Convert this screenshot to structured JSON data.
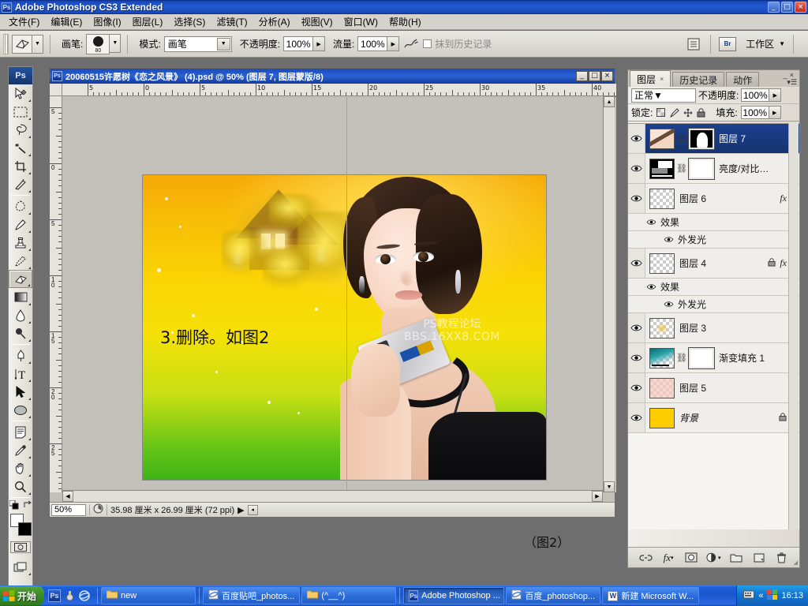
{
  "app": {
    "title": "Adobe Photoshop CS3 Extended",
    "badge": "Ps",
    "min": "_",
    "max": "□",
    "close": "×"
  },
  "menu": {
    "items": [
      {
        "label": "文件(F)"
      },
      {
        "label": "编辑(E)"
      },
      {
        "label": "图像(I)"
      },
      {
        "label": "图层(L)"
      },
      {
        "label": "选择(S)"
      },
      {
        "label": "滤镜(T)"
      },
      {
        "label": "分析(A)"
      },
      {
        "label": "视图(V)"
      },
      {
        "label": "窗口(W)"
      },
      {
        "label": "帮助(H)"
      }
    ]
  },
  "options": {
    "tool_icon": "eraser-icon",
    "brush_label": "画笔:",
    "brush_size": "80",
    "mode_label": "模式:",
    "mode_value": "画笔",
    "opacity_label": "不透明度:",
    "opacity_value": "100%",
    "flow_label": "流量:",
    "flow_value": "100%",
    "airbrush_icon": "airbrush-icon",
    "erase_history_label": "抹到历史记录",
    "palette_icon": "palette-toggle-icon",
    "bridge_icon": "Br",
    "workspace_label": "工作区",
    "workspace_arrow": "▼"
  },
  "toolbar": {
    "badge": "Ps",
    "tools": [
      {
        "name": "move-tool",
        "glyph": "✥",
        "selected": false
      },
      {
        "name": "marquee-tool",
        "glyph": "▭",
        "selected": false
      },
      {
        "name": "lasso-tool",
        "glyph": "◠",
        "selected": false
      },
      {
        "name": "magic-wand-tool",
        "glyph": "✳",
        "selected": false
      },
      {
        "name": "crop-tool",
        "glyph": "⌗",
        "selected": false
      },
      {
        "name": "slice-tool",
        "glyph": "✂",
        "selected": false
      },
      {
        "name": "healing-brush-tool",
        "glyph": "◌",
        "selected": false
      },
      {
        "name": "brush-tool",
        "glyph": "✎",
        "selected": false
      },
      {
        "name": "clone-stamp-tool",
        "glyph": "⛁",
        "selected": false
      },
      {
        "name": "history-brush-tool",
        "glyph": "⟲",
        "selected": false
      },
      {
        "name": "eraser-tool",
        "glyph": "▱",
        "selected": true
      },
      {
        "name": "gradient-tool",
        "glyph": "▤",
        "selected": false
      },
      {
        "name": "blur-tool",
        "glyph": "💧",
        "selected": false
      },
      {
        "name": "dodge-tool",
        "glyph": "⚲",
        "selected": false
      },
      {
        "name": "pen-tool",
        "glyph": "✒",
        "selected": false
      },
      {
        "name": "type-tool",
        "glyph": "T",
        "selected": false
      },
      {
        "name": "path-selection-tool",
        "glyph": "➤",
        "selected": false
      },
      {
        "name": "shape-tool",
        "glyph": "⬭",
        "selected": false
      },
      {
        "name": "notes-tool",
        "glyph": "▤",
        "selected": false
      },
      {
        "name": "eyedropper-tool",
        "glyph": "⟋",
        "selected": false
      },
      {
        "name": "hand-tool",
        "glyph": "✋",
        "selected": false
      },
      {
        "name": "zoom-tool",
        "glyph": "🔍",
        "selected": false
      }
    ],
    "foreground_color": "#ffffff",
    "background_color": "#000000",
    "quickmask_icon": "quick-mask-icon",
    "screenmode_icon": "screen-mode-icon"
  },
  "document": {
    "title": "20060515许愿树《恋之风景》 (4).psd @ 50% (图层 7, 图层蒙版/8)",
    "badge": "Ps",
    "min": "_",
    "max": "□",
    "close": "×",
    "ruler_h": [
      "5",
      "0",
      "5",
      "10",
      "15",
      "20",
      "25",
      "30",
      "35",
      "40"
    ],
    "ruler_v": [
      "5",
      "0",
      "5",
      "10",
      "15",
      "20",
      "25",
      "30"
    ],
    "canvas_text": "3.删除。如图2",
    "watermark_line1": "PS教程论坛",
    "watermark_line2": "BBS.16XX8.COM",
    "status": {
      "zoom": "50%",
      "doc_size": "35.98 厘米 x 26.99 厘米 (72 ppi)",
      "arrow": "▶"
    }
  },
  "figure_caption": "（图2）",
  "panel": {
    "tabs": [
      {
        "label": "图层",
        "active": true,
        "close": "×"
      },
      {
        "label": "历史记录",
        "active": false
      },
      {
        "label": "动作",
        "active": false
      }
    ],
    "minimize": "_",
    "close": "×",
    "menu_icon": "panel-menu-icon",
    "blend_mode": "正常",
    "opacity_label": "不透明度:",
    "opacity_value": "100%",
    "lock_label": "锁定:",
    "lock_icons": [
      "lock-transparency-icon",
      "lock-pixels-icon",
      "lock-position-icon",
      "lock-all-icon"
    ],
    "fill_label": "填充:",
    "fill_value": "100%",
    "layers": [
      {
        "name": "图层 7",
        "selected": true,
        "visible": true,
        "has_mask": true,
        "linked": true,
        "thumb": "portrait",
        "locked": false,
        "fx": false,
        "effects": []
      },
      {
        "name": "亮度/对比…",
        "selected": false,
        "visible": true,
        "has_mask": true,
        "linked": true,
        "thumb": "adjustment",
        "locked": false,
        "fx": false,
        "effects": []
      },
      {
        "name": "图层 6",
        "selected": false,
        "visible": true,
        "has_mask": false,
        "linked": false,
        "thumb": "transparent",
        "locked": false,
        "fx": true,
        "effects": [
          {
            "label": "效果",
            "visible": true,
            "level": 1
          },
          {
            "label": "外发光",
            "visible": true,
            "level": 2
          }
        ]
      },
      {
        "name": "图层 4",
        "selected": false,
        "visible": true,
        "has_mask": false,
        "linked": false,
        "thumb": "transparent",
        "locked": true,
        "fx": true,
        "effects": [
          {
            "label": "效果",
            "visible": true,
            "level": 1
          },
          {
            "label": "外发光",
            "visible": true,
            "level": 2
          }
        ]
      },
      {
        "name": "图层 3",
        "selected": false,
        "visible": true,
        "has_mask": false,
        "linked": false,
        "thumb": "sparkle",
        "locked": false,
        "fx": false,
        "effects": []
      },
      {
        "name": "渐变填充 1",
        "selected": false,
        "visible": true,
        "has_mask": true,
        "linked": true,
        "thumb": "gradient",
        "locked": false,
        "fx": false,
        "effects": []
      },
      {
        "name": "图层 5",
        "selected": false,
        "visible": true,
        "has_mask": false,
        "linked": false,
        "thumb": "pinkish",
        "locked": false,
        "fx": false,
        "effects": []
      },
      {
        "name": "背景",
        "selected": false,
        "visible": true,
        "has_mask": false,
        "linked": false,
        "thumb": "yellow",
        "locked": true,
        "fx": false,
        "italic": true,
        "effects": []
      }
    ],
    "bottom_icons": [
      {
        "name": "link-layers-icon",
        "glyph": "⛓"
      },
      {
        "name": "layer-style-fx-icon",
        "glyph": "fx"
      },
      {
        "name": "add-layer-mask-icon",
        "glyph": "▣"
      },
      {
        "name": "new-adjustment-layer-icon",
        "glyph": "◐"
      },
      {
        "name": "new-group-icon",
        "glyph": "▭"
      },
      {
        "name": "new-layer-icon",
        "glyph": "▣"
      },
      {
        "name": "delete-layer-icon",
        "glyph": "🗑"
      }
    ]
  },
  "taskbar": {
    "start": "开始",
    "quicklaunch": [
      {
        "name": "photoshop-quicklaunch-icon",
        "glyph": "Ps"
      },
      {
        "name": "media-quicklaunch-icon",
        "glyph": "♪"
      },
      {
        "name": "ie-quicklaunch-icon",
        "glyph": "e"
      }
    ],
    "buttons": [
      {
        "label": "new",
        "icon": "folder-icon",
        "active": false
      },
      {
        "label": "百度贴吧_photos...",
        "icon": "ie-icon",
        "active": false
      },
      {
        "label": "(^__^)",
        "icon": "folder-icon",
        "active": false
      },
      {
        "label": "Adobe Photoshop ...",
        "icon": "photoshop-icon",
        "active": true
      },
      {
        "label": "百度_photoshop...",
        "icon": "ie-icon",
        "active": false
      },
      {
        "label": "新建 Microsoft W...",
        "icon": "word-icon",
        "active": false
      }
    ],
    "tray": {
      "ime_icon": "ime-icon",
      "expand": "«",
      "lang_icon": "lang-icon",
      "clock": "16:13"
    }
  }
}
